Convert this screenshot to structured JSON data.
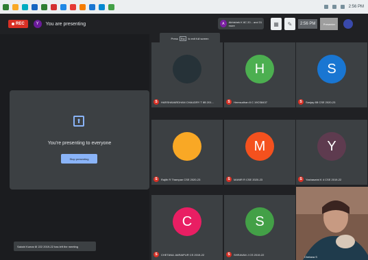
{
  "taskbar": {
    "icon_colors": [
      "#2e7d32",
      "#f9a825",
      "#00acc1",
      "#1565c0",
      "#2e7d32",
      "#d32f2f",
      "#1e88e5",
      "#e53935",
      "#f57c00",
      "#1976d2",
      "#0288d1",
      "#43a047"
    ],
    "clock": "2:56 PM"
  },
  "meetbar": {
    "rec_label": "REC",
    "presenter_initial": "Y",
    "presenting_text": "You are presenting",
    "speaker_initial": "A",
    "speaker_text": "Abhishek K 8C 20... and 31 more",
    "time": "2:56 PM",
    "user_text": "Presenter"
  },
  "presentation": {
    "message": "You're presenting to everyone",
    "stop_button": "Stop presenting"
  },
  "notification": "Sakshi Kumar 8I 222 2019-22 has left the meeting",
  "fullscreen_hint": {
    "before": "Press",
    "key": "Esc",
    "after": "to exit full screen"
  },
  "tiles": [
    {
      "initial": "",
      "color": "#263238",
      "name": "HARSHAVARDHAN CHAUDRY T 8B 201..."
    },
    {
      "initial": "H",
      "color": "#4caf50",
      "name": "Hemsudhan 8 C 19CS8437"
    },
    {
      "initial": "S",
      "color": "#1976d2",
      "name": "Sanjay 8B CSE 2020-23"
    },
    {
      "initial": "",
      "color": "#f9a825",
      "name": "Rajith R Thampan CSE 2020-23"
    },
    {
      "initial": "M",
      "color": "#f4511e",
      "name": "MANIR R CSE 2020-23"
    },
    {
      "initial": "Y",
      "color": "#5e3b4f",
      "name": "Yashaswini K 4 CSE 2019-22"
    },
    {
      "initial": "C",
      "color": "#e91e63",
      "name": "CHETANA JAIRAIPUR CS 2019-22"
    },
    {
      "initial": "S",
      "color": "#43a047",
      "name": "SHRAVAN J CS 2019-22"
    }
  ],
  "camera": {
    "name": "Chetana S"
  }
}
